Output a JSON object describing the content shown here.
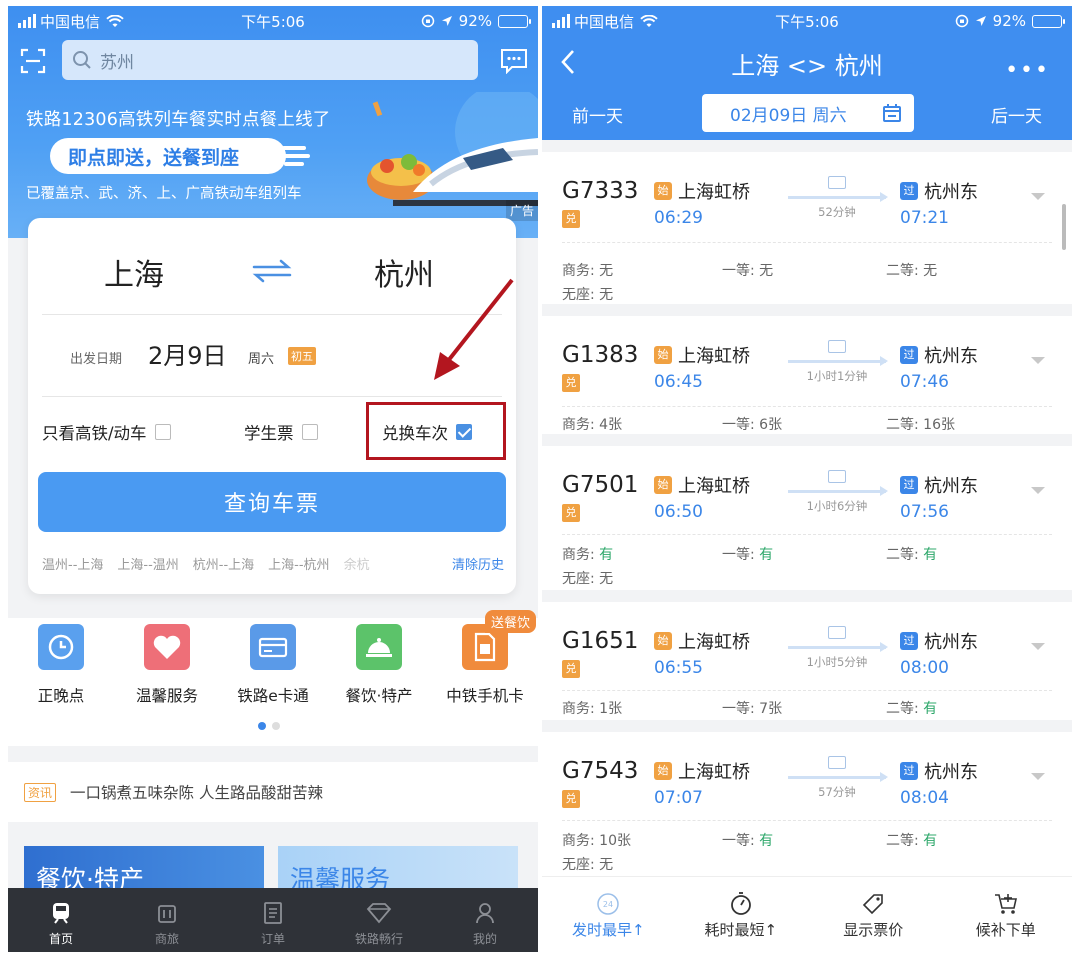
{
  "left": {
    "status": {
      "carrier": "中国电信",
      "time": "下午5:06",
      "battery": "92%"
    },
    "search": {
      "placeholder": "苏州"
    },
    "banner": {
      "title": "铁路12306高铁列车餐实时点餐上线了",
      "pill": "即点即送，送餐到座",
      "sub": "已覆盖京、武、济、上、广高铁动车组列车",
      "ad": "广告"
    },
    "query": {
      "from": "上海",
      "to": "杭州",
      "date_label": "出发日期",
      "date": "2月9日",
      "weekday": "周六",
      "lunar": "初五",
      "opt_highspeed": "只看高铁/动车",
      "opt_student": "学生票",
      "opt_exchange": "兑换车次",
      "button": "查询车票",
      "history": [
        "温州--上海",
        "上海--温州",
        "杭州--上海",
        "上海--杭州",
        "余杭"
      ],
      "clear": "清除历史"
    },
    "grid": [
      {
        "label": "正晚点",
        "icon": "clock-icon",
        "color": "#5aa0ee"
      },
      {
        "label": "温馨服务",
        "icon": "heart-icon",
        "color": "#ee6f78"
      },
      {
        "label": "铁路e卡通",
        "icon": "card-icon",
        "color": "#5a9ae8"
      },
      {
        "label": "餐饮·特产",
        "icon": "dish-icon",
        "color": "#5cc36a"
      },
      {
        "label": "中铁手机卡",
        "icon": "simcard-icon",
        "color": "#f08b3c"
      }
    ],
    "grid_badge": "送餐饮",
    "news": {
      "tag": "资讯",
      "text": "一口锅煮五味杂陈 人生路品酸甜苦辣"
    },
    "promos": [
      "餐饮·特产",
      "温馨服务"
    ],
    "tabs": [
      "首页",
      "商旅",
      "订单",
      "铁路畅行",
      "我的"
    ]
  },
  "right": {
    "status": {
      "carrier": "中国电信",
      "time": "下午5:06",
      "battery": "92%"
    },
    "title": "上海 <> 杭州",
    "prev_day": "前一天",
    "next_day": "后一天",
    "date": "02月09日 周六",
    "trains": [
      {
        "code": "G7333",
        "dui": "兑",
        "from_tag": "始",
        "from": "上海虹桥",
        "dep": "06:29",
        "duration": "52分钟",
        "to_tag": "过",
        "to": "杭州东",
        "arr": "07:21",
        "seats": [
          {
            "label": "商务: ",
            "val": "无"
          },
          {
            "label": "一等: ",
            "val": "无"
          },
          {
            "label": "二等: ",
            "val": "无"
          },
          {
            "label": "无座: ",
            "val": "无"
          }
        ]
      },
      {
        "code": "G1383",
        "dui": "兑",
        "from_tag": "始",
        "from": "上海虹桥",
        "dep": "06:45",
        "duration": "1小时1分钟",
        "to_tag": "过",
        "to": "杭州东",
        "arr": "07:46",
        "seats": [
          {
            "label": "商务: ",
            "val": "4张"
          },
          {
            "label": "一等: ",
            "val": "6张"
          },
          {
            "label": "二等: ",
            "val": "16张"
          }
        ]
      },
      {
        "code": "G7501",
        "dui": "兑",
        "from_tag": "始",
        "from": "上海虹桥",
        "dep": "06:50",
        "duration": "1小时6分钟",
        "to_tag": "过",
        "to": "杭州东",
        "arr": "07:56",
        "seats": [
          {
            "label": "商务: ",
            "val": "有"
          },
          {
            "label": "一等: ",
            "val": "有"
          },
          {
            "label": "二等: ",
            "val": "有"
          },
          {
            "label": "无座: ",
            "val": "无"
          }
        ]
      },
      {
        "code": "G1651",
        "dui": "兑",
        "from_tag": "始",
        "from": "上海虹桥",
        "dep": "06:55",
        "duration": "1小时5分钟",
        "to_tag": "过",
        "to": "杭州东",
        "arr": "08:00",
        "seats": [
          {
            "label": "商务: ",
            "val": "1张"
          },
          {
            "label": "一等: ",
            "val": "7张"
          },
          {
            "label": "二等: ",
            "val": "有"
          }
        ]
      },
      {
        "code": "G7543",
        "dui": "兑",
        "from_tag": "始",
        "from": "上海虹桥",
        "dep": "07:07",
        "duration": "57分钟",
        "to_tag": "过",
        "to": "杭州东",
        "arr": "08:04",
        "seats": [
          {
            "label": "商务: ",
            "val": "10张"
          },
          {
            "label": "一等: ",
            "val": "有"
          },
          {
            "label": "二等: ",
            "val": "有"
          },
          {
            "label": "无座: ",
            "val": "无"
          }
        ]
      }
    ],
    "bottom": [
      "发时最早↑",
      "耗时最短↑",
      "显示票价",
      "候补下单"
    ],
    "bottom_badge": "24"
  }
}
